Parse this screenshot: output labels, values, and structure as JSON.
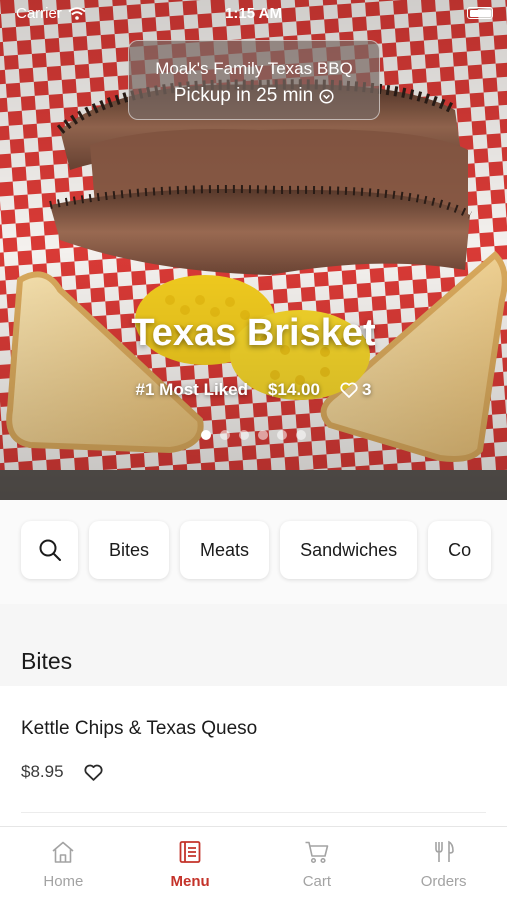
{
  "status_bar": {
    "carrier": "Carrier",
    "time": "1:15 AM"
  },
  "hero": {
    "restaurant_name": "Moak's Family Texas BBQ",
    "pickup_text": "Pickup in 25 min",
    "title": "Texas Brisket",
    "rank": "#1 Most Liked",
    "price": "$14.00",
    "likes": "3",
    "carousel_count": 6,
    "carousel_active": 0
  },
  "categories": [
    {
      "label": "Bites"
    },
    {
      "label": "Meats"
    },
    {
      "label": "Sandwiches"
    },
    {
      "label": "Co"
    }
  ],
  "section": {
    "title": "Bites"
  },
  "items": [
    {
      "name": "Kettle Chips & Texas Queso",
      "price": "$8.95"
    }
  ],
  "tabs": [
    {
      "label": "Home",
      "icon": "home-icon"
    },
    {
      "label": "Menu",
      "icon": "menu-icon"
    },
    {
      "label": "Cart",
      "icon": "cart-icon"
    },
    {
      "label": "Orders",
      "icon": "orders-icon"
    }
  ],
  "active_tab": "Menu",
  "colors": {
    "accent": "#c4332a",
    "inactive": "#a3a3a3",
    "checker_red": "#d93a36"
  }
}
